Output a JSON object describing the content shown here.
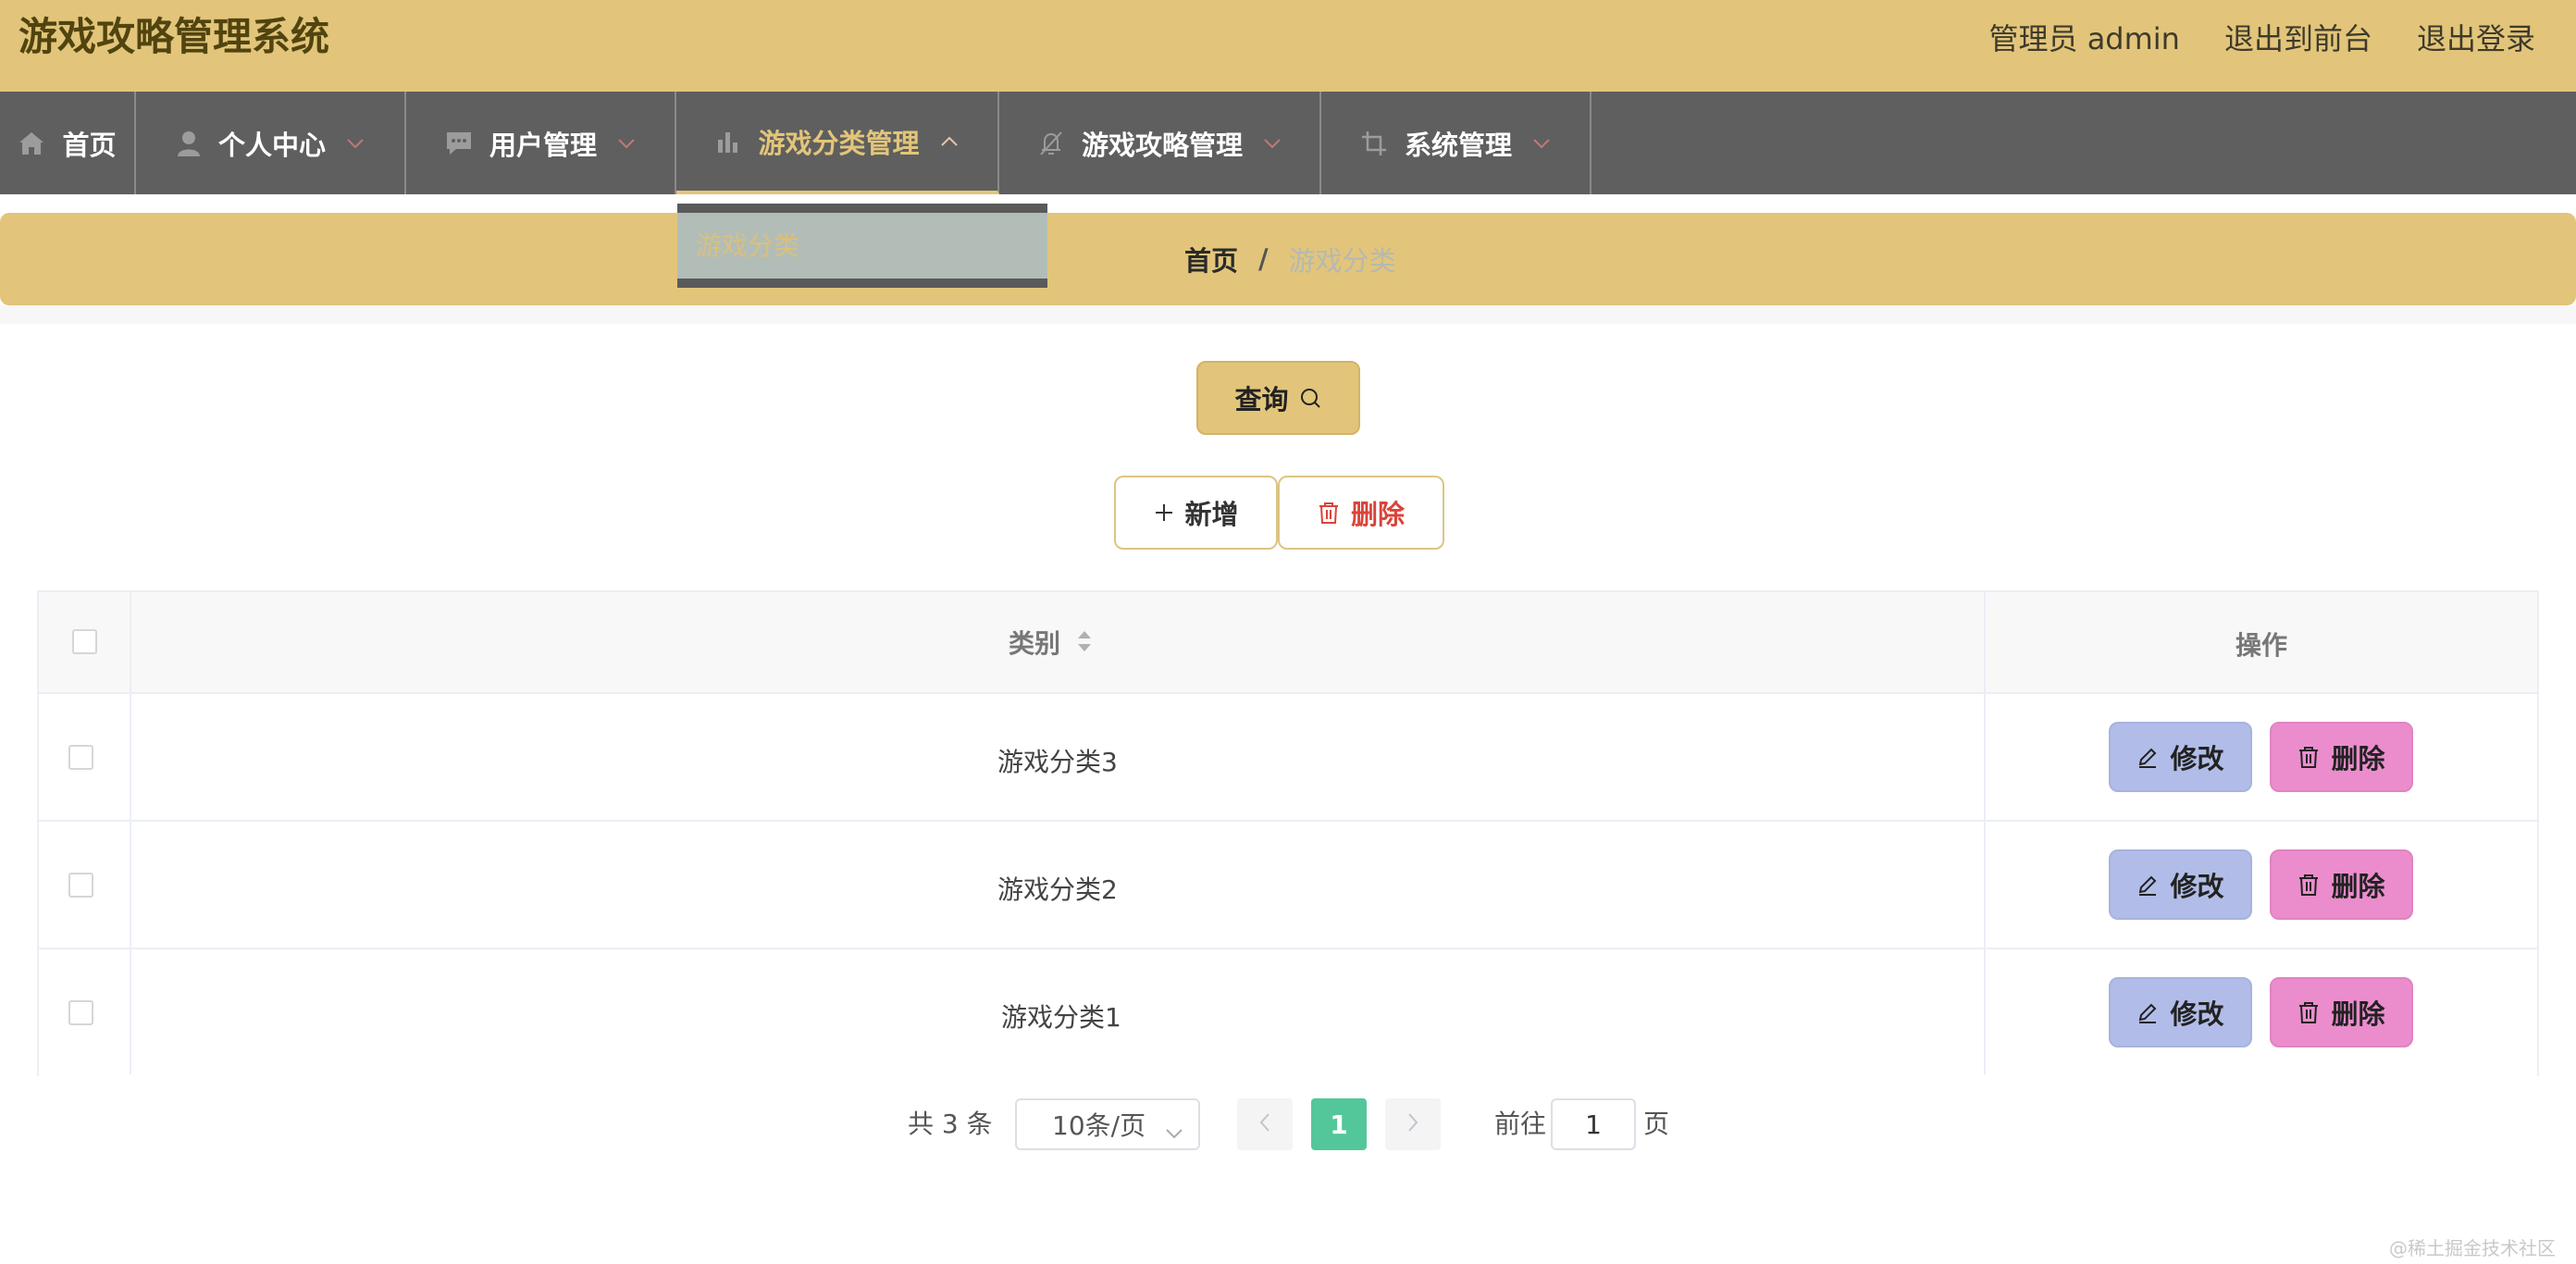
{
  "header": {
    "title": "游戏攻略管理系统",
    "admin": "管理员 admin",
    "to_front": "退出到前台",
    "logout": "退出登录"
  },
  "nav": {
    "items": [
      {
        "label": "首页",
        "icon": "home-icon"
      },
      {
        "label": "个人中心",
        "icon": "user-icon"
      },
      {
        "label": "用户管理",
        "icon": "chat-icon"
      },
      {
        "label": "游戏分类管理",
        "icon": "bar-chart-icon"
      },
      {
        "label": "游戏攻略管理",
        "icon": "bell-off-icon"
      },
      {
        "label": "系统管理",
        "icon": "crop-icon"
      }
    ],
    "dropdown_item": "游戏分类"
  },
  "breadcrumb": {
    "home": "首页",
    "sep": "/",
    "current": "游戏分类"
  },
  "actions": {
    "query": "查询",
    "add": "新增",
    "delete": "删除"
  },
  "table": {
    "headers": [
      "类别",
      "操作"
    ],
    "rows": [
      {
        "category": "游戏分类3"
      },
      {
        "category": "游戏分类2"
      },
      {
        "category": "游戏分类1"
      }
    ],
    "edit_label": "修改",
    "delete_label": "删除"
  },
  "pagination": {
    "total": "共 3 条",
    "page_size": "10条/页",
    "current_page": "1",
    "goto_label": "前往",
    "goto_value": "1",
    "page_label": "页"
  },
  "watermark": "@稀土掘金技术社区",
  "colors": {
    "accent": "#e2c57a",
    "nav_bg": "#5f5f5f",
    "edit_button": "#b1bde8",
    "delete_button": "#eb8dcd",
    "page_active": "#53c79a"
  }
}
